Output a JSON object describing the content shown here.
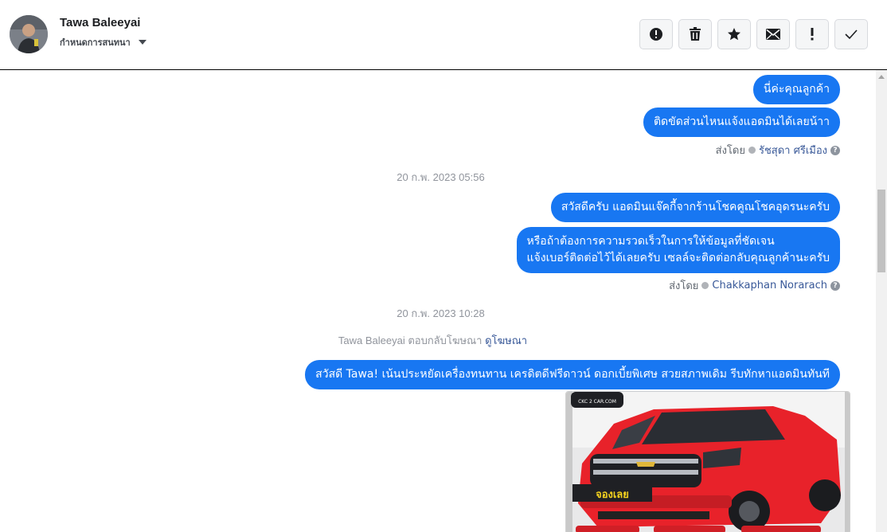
{
  "header": {
    "user_name": "Tawa Baleeyai",
    "assign_label": "กำหนดการสนทนา"
  },
  "toolbar": [
    {
      "icon": "alert-circle-icon"
    },
    {
      "icon": "trash-icon"
    },
    {
      "icon": "star-icon"
    },
    {
      "icon": "envelope-icon"
    },
    {
      "icon": "exclamation-icon"
    },
    {
      "icon": "check-icon"
    }
  ],
  "messages": {
    "m1": "นี่ค่ะคุณลูกค้า",
    "m2": "ติดขัดส่วนไหนแจ้งแอดมินได้เลยน้าา",
    "sent1_prefix": "ส่งโดย",
    "sent1_name": "รัชสุดา ศรีเมือง",
    "ts1": "20 ก.พ. 2023 05:56",
    "m3": "สวัสดีครับ แอดมินแจ๊คกี้จากร้านโชคคูณโชคอุดรนะครับ",
    "m4_line1": "หรือถ้าต้องการความรวดเร็วในการให้ข้อมูลที่ชัดเจน",
    "m4_line2": "แจ้งเบอร์ติดต่อไว้ได้เลยครับ เซลล์จะติดต่อกลับคุณลูกค้านะครับ",
    "sent2_prefix": "ส่งโดย",
    "sent2_name": "Chakkaphan Norarach",
    "ts2": "20 ก.พ. 2023 10:28",
    "ad_reply_text": "Tawa Baleeyai ตอบกลับโฆษณา",
    "ad_reply_link": "ดูโฆษณา",
    "m5": "สวัสดี Tawa!  เน้นประหยัดเครื่องทนทาน  เครดิตดีฟรีดาวน์ ดอกเบี้ยพิเศษ สวยสภาพเดิม รีบทักหาแอดมินทันที"
  },
  "ad_image": {
    "logo_text": "CKC 2 CAR.COM",
    "badge_text": "จองเลย"
  },
  "colors": {
    "bubble": "#1877f2",
    "car": "#e8222a"
  }
}
